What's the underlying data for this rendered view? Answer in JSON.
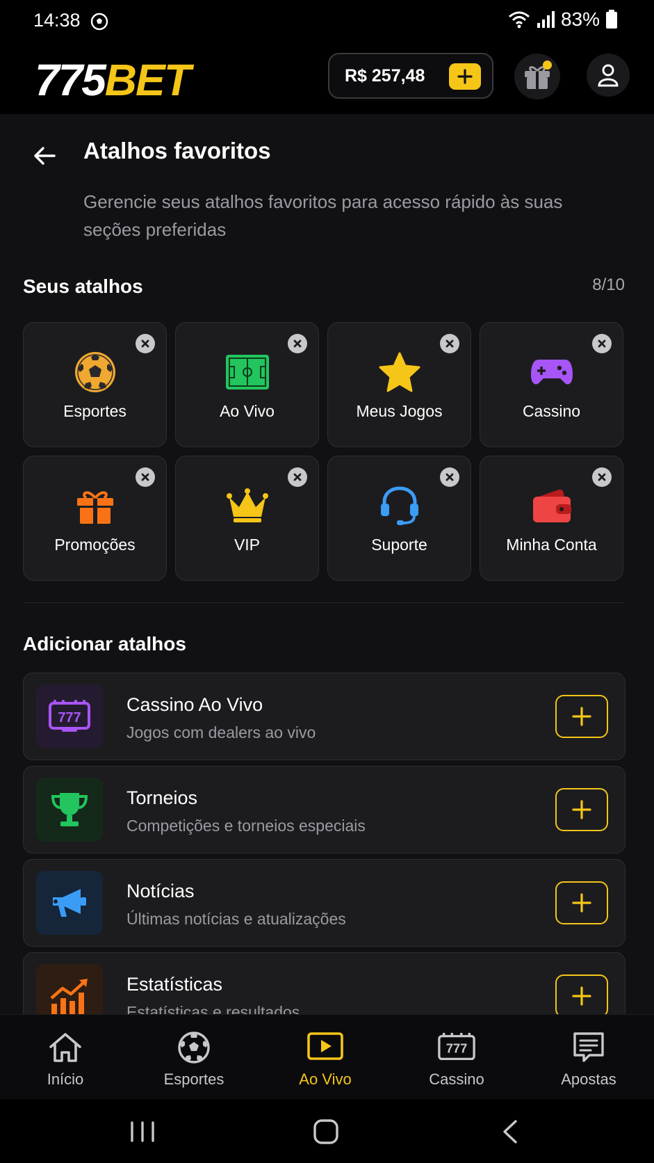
{
  "status": {
    "time": "14:38",
    "battery": "83%"
  },
  "header": {
    "logo_white": "775",
    "logo_yellow": "BET",
    "balance": "R$ 257,48",
    "colors": {
      "accent": "#f5c518"
    }
  },
  "page": {
    "title": "Atalhos favoritos",
    "description": "Gerencie seus atalhos favoritos para acesso rápido às suas seções preferidas"
  },
  "favorites": {
    "title": "Seus atalhos",
    "count": "8/10",
    "items": [
      {
        "label": "Esportes",
        "icon": "soccer-ball-icon",
        "color": "#f0a830"
      },
      {
        "label": "Ao Vivo",
        "icon": "live-field-icon",
        "color": "#22c55e"
      },
      {
        "label": "Meus Jogos",
        "icon": "star-icon",
        "color": "#f5c518"
      },
      {
        "label": "Cassino",
        "icon": "gamepad-icon",
        "color": "#a855f7"
      },
      {
        "label": "Promoções",
        "icon": "gift-icon",
        "color": "#f97316"
      },
      {
        "label": "VIP",
        "icon": "crown-icon",
        "color": "#f5c518"
      },
      {
        "label": "Suporte",
        "icon": "headset-icon",
        "color": "#3b9cf6"
      },
      {
        "label": "Minha Conta",
        "icon": "wallet-icon",
        "color": "#ef4444"
      }
    ]
  },
  "add": {
    "title": "Adicionar atalhos",
    "items": [
      {
        "title": "Cassino Ao Vivo",
        "subtitle": "Jogos com dealers ao vivo",
        "icon": "slot-777-icon",
        "color": "#a855f7"
      },
      {
        "title": "Torneios",
        "subtitle": "Competições e torneios especiais",
        "icon": "trophy-icon",
        "color": "#22c55e"
      },
      {
        "title": "Notícias",
        "subtitle": "Últimas notícias e atualizações",
        "icon": "megaphone-icon",
        "color": "#3b9cf6"
      },
      {
        "title": "Estatísticas",
        "subtitle": "Estatísticas e resultados",
        "icon": "chart-up-icon",
        "color": "#f97316"
      }
    ]
  },
  "nav": {
    "items": [
      {
        "label": "Início",
        "icon": "home-icon",
        "active": false
      },
      {
        "label": "Esportes",
        "icon": "soccer-ball-icon",
        "active": false
      },
      {
        "label": "Ao Vivo",
        "icon": "play-icon",
        "active": true
      },
      {
        "label": "Cassino",
        "icon": "slot-777-icon",
        "active": false
      },
      {
        "label": "Apostas",
        "icon": "ticket-icon",
        "active": false
      }
    ]
  }
}
